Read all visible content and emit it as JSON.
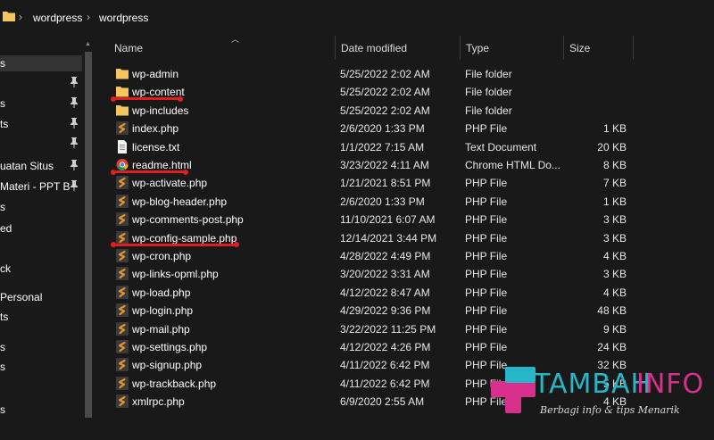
{
  "breadcrumb": [
    "wordpress",
    "wordpress"
  ],
  "nav": {
    "items": [
      {
        "label": "s",
        "pinned": false,
        "selected": true
      },
      {
        "label": "",
        "pinned": true,
        "selected": false
      },
      {
        "label": "s",
        "pinned": true,
        "selected": false
      },
      {
        "label": "ts",
        "pinned": true,
        "selected": false
      },
      {
        "label": "",
        "pinned": true,
        "selected": false
      },
      {
        "label": "uatan Situs",
        "pinned": true,
        "selected": false
      },
      {
        "label": " Materi - PPT B",
        "pinned": true,
        "selected": false
      },
      {
        "label": "s",
        "pinned": false,
        "selected": false
      },
      {
        "label": "ed",
        "pinned": false,
        "selected": false
      },
      {
        "label": "ck",
        "pinned": false,
        "selected": false
      },
      {
        "label": "Personal",
        "pinned": false,
        "selected": false
      },
      {
        "label": "ts",
        "pinned": false,
        "selected": false
      },
      {
        "label": "s",
        "pinned": false,
        "selected": false
      },
      {
        "label": "s",
        "pinned": false,
        "selected": false
      },
      {
        "label": "s",
        "pinned": false,
        "selected": false
      }
    ]
  },
  "columns": {
    "name": "Name",
    "date": "Date modified",
    "type": "Type",
    "size": "Size"
  },
  "files": [
    {
      "name": "wp-admin",
      "date": "5/25/2022 2:02 AM",
      "type": "File folder",
      "size": "",
      "icon": "folder-icon",
      "highlight": false
    },
    {
      "name": "wp-content",
      "date": "5/25/2022 2:02 AM",
      "type": "File folder",
      "size": "",
      "icon": "folder-icon",
      "highlight": true
    },
    {
      "name": "wp-includes",
      "date": "5/25/2022 2:02 AM",
      "type": "File folder",
      "size": "",
      "icon": "folder-icon",
      "highlight": false
    },
    {
      "name": "index.php",
      "date": "2/6/2020 1:33 PM",
      "type": "PHP File",
      "size": "1 KB",
      "icon": "php-file-icon",
      "highlight": false
    },
    {
      "name": "license.txt",
      "date": "1/1/2022 7:15 AM",
      "type": "Text Document",
      "size": "20 KB",
      "icon": "text-file-icon",
      "highlight": false
    },
    {
      "name": "readme.html",
      "date": "3/23/2022 4:11 AM",
      "type": "Chrome HTML Do...",
      "size": "8 KB",
      "icon": "chrome-icon",
      "highlight": true
    },
    {
      "name": "wp-activate.php",
      "date": "1/21/2021 8:51 PM",
      "type": "PHP File",
      "size": "7 KB",
      "icon": "php-file-icon",
      "highlight": false
    },
    {
      "name": "wp-blog-header.php",
      "date": "2/6/2020 1:33 PM",
      "type": "PHP File",
      "size": "1 KB",
      "icon": "php-file-icon",
      "highlight": false
    },
    {
      "name": "wp-comments-post.php",
      "date": "11/10/2021 6:07 AM",
      "type": "PHP File",
      "size": "3 KB",
      "icon": "php-file-icon",
      "highlight": false
    },
    {
      "name": "wp-config-sample.php",
      "date": "12/14/2021 3:44 PM",
      "type": "PHP File",
      "size": "3 KB",
      "icon": "php-file-icon",
      "highlight": true
    },
    {
      "name": "wp-cron.php",
      "date": "4/28/2022 4:49 PM",
      "type": "PHP File",
      "size": "4 KB",
      "icon": "php-file-icon",
      "highlight": false
    },
    {
      "name": "wp-links-opml.php",
      "date": "3/20/2022 3:31 AM",
      "type": "PHP File",
      "size": "3 KB",
      "icon": "php-file-icon",
      "highlight": false
    },
    {
      "name": "wp-load.php",
      "date": "4/12/2022 8:47 AM",
      "type": "PHP File",
      "size": "4 KB",
      "icon": "php-file-icon",
      "highlight": false
    },
    {
      "name": "wp-login.php",
      "date": "4/29/2022 9:36 PM",
      "type": "PHP File",
      "size": "48 KB",
      "icon": "php-file-icon",
      "highlight": false
    },
    {
      "name": "wp-mail.php",
      "date": "3/22/2022 11:25 PM",
      "type": "PHP File",
      "size": "9 KB",
      "icon": "php-file-icon",
      "highlight": false
    },
    {
      "name": "wp-settings.php",
      "date": "4/12/2022 4:26 PM",
      "type": "PHP File",
      "size": "24 KB",
      "icon": "php-file-icon",
      "highlight": false
    },
    {
      "name": "wp-signup.php",
      "date": "4/11/2022 6:42 PM",
      "type": "PHP File",
      "size": "32 KB",
      "icon": "php-file-icon",
      "highlight": false
    },
    {
      "name": "wp-trackback.php",
      "date": "4/11/2022 6:42 PM",
      "type": "PHP File",
      "size": "5 KB",
      "icon": "php-file-icon",
      "highlight": false
    },
    {
      "name": "xmlrpc.php",
      "date": "6/9/2020 2:55 AM",
      "type": "PHP File",
      "size": "4 KB",
      "icon": "php-file-icon",
      "highlight": false
    }
  ],
  "watermark": {
    "brand_a": "TAMBAH",
    "brand_b": "INFO",
    "tagline": "Berbagi info & tips Menarik"
  },
  "colors": {
    "highlight_underline": "#e01e1e",
    "folder": "#f3c75c",
    "php": "#e2942a",
    "brand_teal": "#27b6c9",
    "brand_pink": "#d6308c"
  }
}
